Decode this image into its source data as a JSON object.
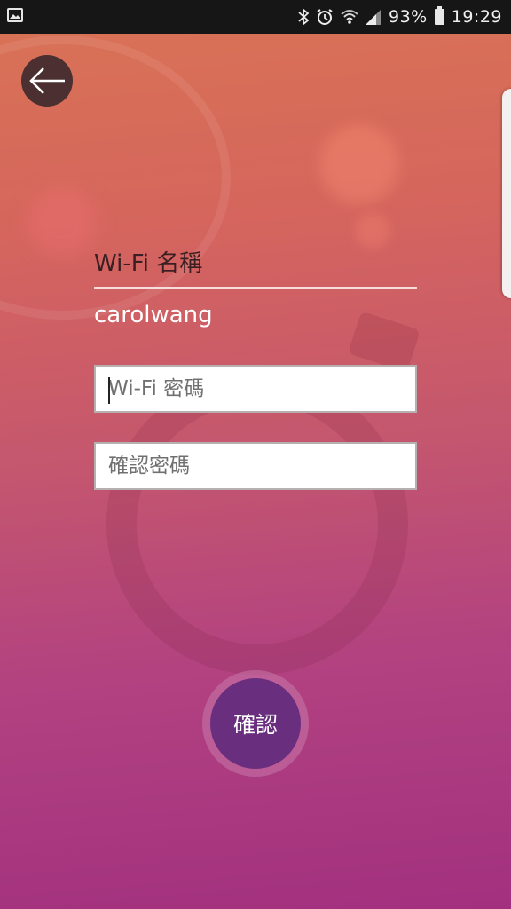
{
  "status_bar": {
    "battery": "93%",
    "time": "19:29",
    "icons": [
      "gallery-icon",
      "bluetooth-icon",
      "alarm-icon",
      "wifi-icon",
      "signal-icon",
      "battery-icon"
    ]
  },
  "nav": {
    "back_icon": "arrow-left-icon"
  },
  "wifi": {
    "name_label": "Wi-Fi 名稱",
    "name_value": "carolwang",
    "password_placeholder": "Wi-Fi 密碼",
    "confirm_password_placeholder": "確認密碼"
  },
  "actions": {
    "confirm_label": "確認"
  },
  "colors": {
    "bg_top": "#d97455",
    "bg_bottom": "#a2307f",
    "confirm_button": "#6a2e7f",
    "back_button": "#4b2f31"
  }
}
